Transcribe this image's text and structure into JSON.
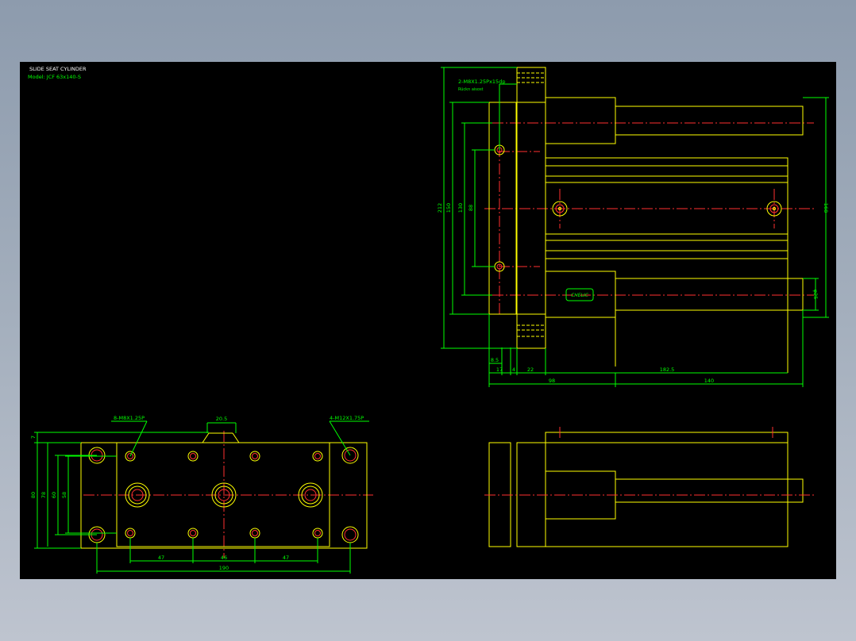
{
  "title": {
    "line1": "SLIDE SEAT CYLINDER",
    "line2": "Model: JCF 63x140-S"
  },
  "colors": {
    "background": "#000000",
    "outline": "#ffff00",
    "centerline": "#ff3030",
    "dimension": "#00ff00",
    "hole_inner": "#ff3030"
  },
  "top_view": {
    "callout_thread": "2-M8X1.25Px15dp",
    "callout_note": "Rückn aisost",
    "dims_vertical": [
      "212",
      "150",
      "130",
      "88"
    ],
    "dim_right": "168",
    "dim_rod": "φ25",
    "dims_bottom_small": [
      "8.5",
      "17",
      "4",
      "22"
    ],
    "dim_stroke_offset": "182.5",
    "dims_bottom_total": [
      "98",
      "140"
    ],
    "nameplate": "CHELIC"
  },
  "front_view": {
    "callout_left": "8-M8X1.25P",
    "callout_right": "4-M12X1.75P",
    "callout_top": "20.5",
    "dims_vertical": [
      "7",
      "80",
      "78",
      "60",
      "58"
    ],
    "dims_bottom": [
      "47",
      "46",
      "47"
    ],
    "dim_total": "190"
  }
}
